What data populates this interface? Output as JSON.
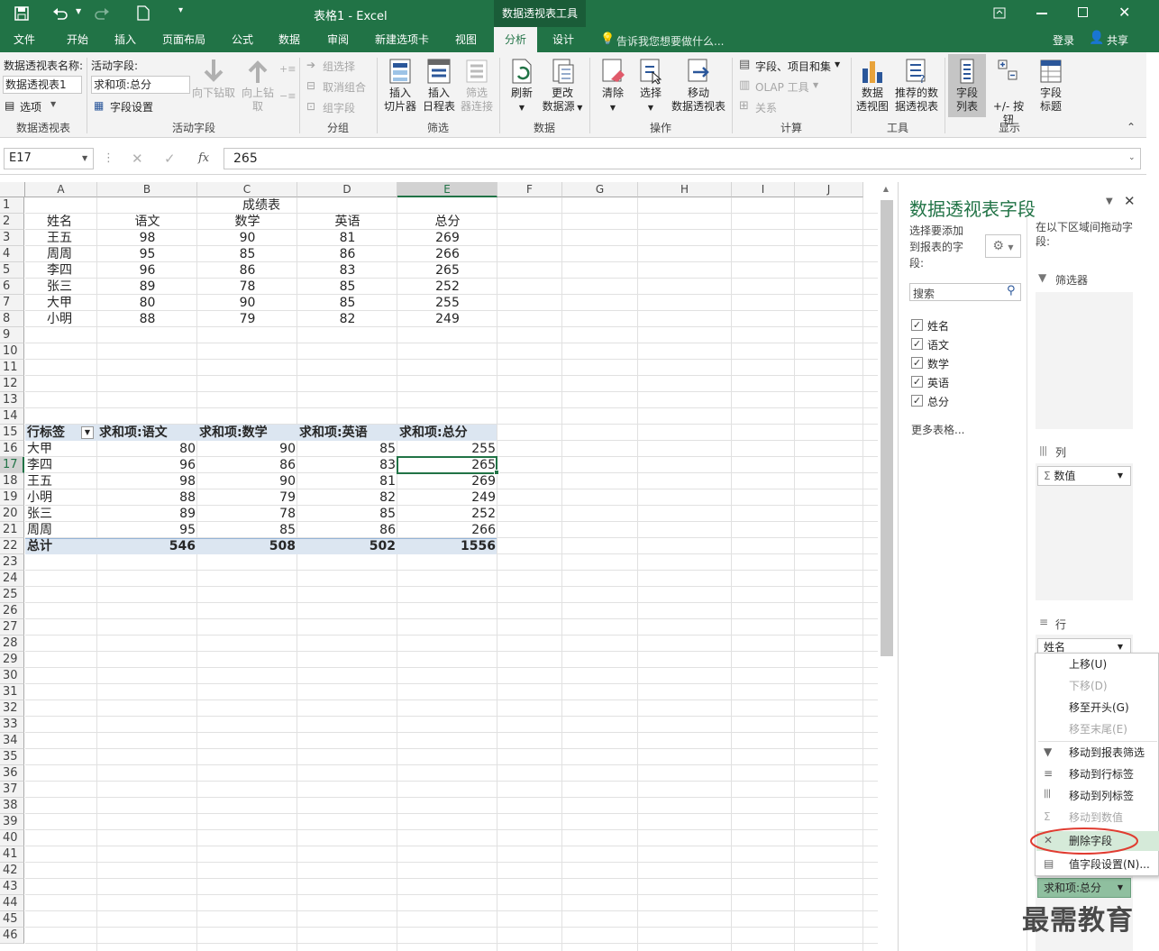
{
  "app": {
    "title": "表格1 - Excel",
    "context_tool": "数据透视表工具",
    "colors": {
      "accent": "#217346",
      "pivot_header": "#dce6f1",
      "selection": "#217346",
      "highlight_circle": "#e03c31"
    }
  },
  "quick_access": {
    "save_icon": "save-icon",
    "undo_icon": "undo-icon",
    "redo_icon": "redo-icon",
    "new_icon": "new-file-icon"
  },
  "window_buttons": {
    "restore_ribbon": "ribbon-display-icon",
    "minimize": "minimize-icon",
    "maximize": "maximize-icon",
    "close": "close-icon"
  },
  "tabs": [
    "文件",
    "开始",
    "插入",
    "页面布局",
    "公式",
    "数据",
    "审阅",
    "新建选项卡",
    "视图",
    "分析",
    "设计"
  ],
  "active_tab": "分析",
  "tell_me": "告诉我您想要做什么...",
  "login": "登录",
  "share": "共享",
  "ribbon": {
    "pivot_name_label": "数据透视表名称:",
    "pivot_name_value": "数据透视表1",
    "options": "选项",
    "active_field_label": "活动字段:",
    "active_field_value": "求和项:总分",
    "field_settings": "字段设置",
    "drill_down": "向下钻取",
    "drill_up_1": "向上钻",
    "drill_up_2": "取",
    "group_selection": "组选择",
    "ungroup": "取消组合",
    "group_field": "组字段",
    "insert_slicer_1": "插入",
    "insert_slicer_2": "切片器",
    "insert_timeline_1": "插入",
    "insert_timeline_2": "日程表",
    "filter_conn_1": "筛选",
    "filter_conn_2": "器连接",
    "refresh": "刷新",
    "change_source_1": "更改",
    "change_source_2": "数据源",
    "clear": "清除",
    "select": "选择",
    "move_pivot_1": "移动",
    "move_pivot_2": "数据透视表",
    "fields_items_sets": "字段、项目和集",
    "olap_tools": "OLAP 工具",
    "relationships": "关系",
    "pivotchart_1": "数据",
    "pivotchart_2": "透视图",
    "recommended_1": "推荐的数",
    "recommended_2": "据透视表",
    "field_list_1": "字段",
    "field_list_2": "列表",
    "plus_minus": "+/- 按钮",
    "field_headers_1": "字段",
    "field_headers_2": "标题",
    "groups": {
      "pivot": "数据透视表",
      "active_field": "活动字段",
      "group": "分组",
      "filter": "筛选",
      "data": "数据",
      "actions": "操作",
      "calc": "计算",
      "tools": "工具",
      "show": "显示"
    }
  },
  "formula_bar": {
    "name_box": "E17",
    "fx": "fx",
    "value": "265"
  },
  "sheet": {
    "columns": [
      "A",
      "B",
      "C",
      "D",
      "E",
      "F",
      "G",
      "H",
      "I",
      "J"
    ],
    "rows": [
      "1",
      "2",
      "3",
      "4",
      "5",
      "6",
      "7",
      "8",
      "9",
      "10",
      "11",
      "12",
      "13",
      "14",
      "15",
      "16",
      "17",
      "18",
      "19",
      "20",
      "21",
      "22",
      "23",
      "24",
      "25",
      "26",
      "27",
      "28",
      "29",
      "30",
      "31",
      "32",
      "33",
      "34",
      "35",
      "36",
      "37",
      "38",
      "39",
      "40",
      "41",
      "42",
      "43",
      "44",
      "45",
      "46"
    ],
    "title": "成绩表",
    "headers": [
      "姓名",
      "语文",
      "数学",
      "英语",
      "总分"
    ],
    "data": [
      [
        "王五",
        "98",
        "90",
        "81",
        "269"
      ],
      [
        "周周",
        "95",
        "85",
        "86",
        "266"
      ],
      [
        "李四",
        "96",
        "86",
        "83",
        "265"
      ],
      [
        "张三",
        "89",
        "78",
        "85",
        "252"
      ],
      [
        "大甲",
        "80",
        "90",
        "85",
        "255"
      ],
      [
        "小明",
        "88",
        "79",
        "82",
        "249"
      ]
    ],
    "pivot_headers": [
      "行标签",
      "求和项:语文",
      "求和项:数学",
      "求和项:英语",
      "求和项:总分"
    ],
    "pivot_rows": [
      [
        "大甲",
        "80",
        "90",
        "85",
        "255"
      ],
      [
        "李四",
        "96",
        "86",
        "83",
        "265"
      ],
      [
        "王五",
        "98",
        "90",
        "81",
        "269"
      ],
      [
        "小明",
        "88",
        "79",
        "82",
        "249"
      ],
      [
        "张三",
        "89",
        "78",
        "85",
        "252"
      ],
      [
        "周周",
        "95",
        "85",
        "86",
        "266"
      ]
    ],
    "pivot_total": [
      "总计",
      "546",
      "508",
      "502",
      "1556"
    ]
  },
  "panel": {
    "title": "数据透视表字段",
    "choose_label": "选择要添加到报表的字段:",
    "drag_label": "在以下区域间拖动字段:",
    "search_placeholder": "搜索",
    "fields": [
      "姓名",
      "语文",
      "数学",
      "英语",
      "总分"
    ],
    "more_tables": "更多表格...",
    "filters": "筛选器",
    "columns": "列",
    "values_chip": "数值",
    "rows": "行",
    "row_chip": "姓名",
    "value_chip": "求和项:总分"
  },
  "context_menu": {
    "items": [
      "上移(U)",
      "下移(D)",
      "移至开头(G)",
      "移至末尾(E)",
      "移动到报表筛选",
      "移动到行标签",
      "移动到列标签",
      "移动到数值",
      "删除字段",
      "值字段设置(N)..."
    ],
    "disabled": [
      false,
      true,
      false,
      true,
      false,
      false,
      false,
      true,
      false,
      false
    ]
  },
  "watermark": "最需教育"
}
